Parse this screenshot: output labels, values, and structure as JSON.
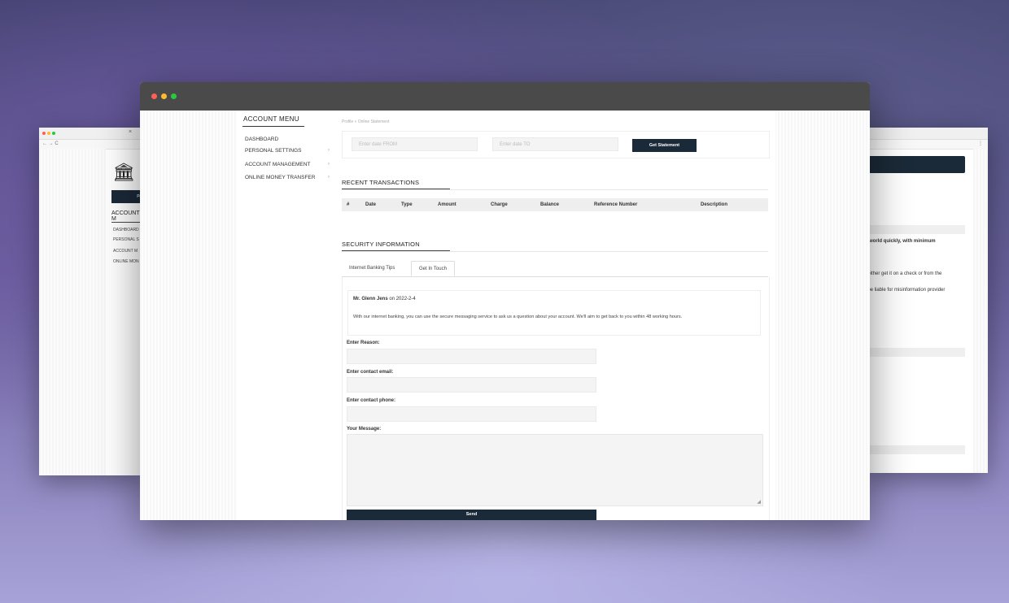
{
  "colors": {
    "accent": "#1b2a38",
    "titlebar": "#4a4a4a",
    "dot_red": "#ff5f57",
    "dot_yellow": "#febc2e",
    "dot_green": "#28c840"
  },
  "bg_left": {
    "tab_close": "×",
    "nav": "← → C",
    "logo_icon": "bank-building-icon",
    "button_label": "Per",
    "menu_title": "ACCOUNT M",
    "items": [
      "DASHBOARD",
      "PERSONAL S",
      "ACCOUNT M",
      "ONLINE MON"
    ]
  },
  "bg_right": {
    "menu_dots": "⋮",
    "texts": [
      "s world quickly, with minimum",
      ", either get it on a check or from the",
      "t be liable for misinformation provider"
    ]
  },
  "sidebar": {
    "title": "ACCOUNT MENU",
    "items": [
      {
        "label": "DASHBOARD",
        "chevron": ""
      },
      {
        "label": "PERSONAL SETTINGS",
        "chevron": "›"
      },
      {
        "label": "ACCOUNT MANAGEMENT",
        "chevron": "›"
      },
      {
        "label": "ONLINE MONEY TRANSFER",
        "chevron": "›"
      }
    ]
  },
  "breadcrumb": "Profile  »  Online Statement",
  "filter": {
    "from_placeholder": "Enter date FROM",
    "to_placeholder": "Enter date TO",
    "button": "Get Statement"
  },
  "transactions": {
    "title": "RECENT TRANSACTIONS",
    "columns": [
      "#",
      "Date",
      "Type",
      "Amount",
      "Charge",
      "Balance",
      "Reference Number",
      "Description"
    ]
  },
  "security": {
    "title": "SECURITY INFORMATION",
    "tabs": [
      "Internet Banking Tips",
      "Get In Touch"
    ],
    "notice_name": "Mr. Glenn Jens",
    "notice_date": " on 2022-2-4",
    "notice_body": "With our internet banking, you can use the secure messaging service to ask us a question about your account. We'll aim to get back to you within 48 working hours."
  },
  "form": {
    "reason_label": "Enter Reason:",
    "email_label": "Enter contact email:",
    "phone_label": "Enter contact phone:",
    "message_label": "Your Message:",
    "send": "Send"
  }
}
